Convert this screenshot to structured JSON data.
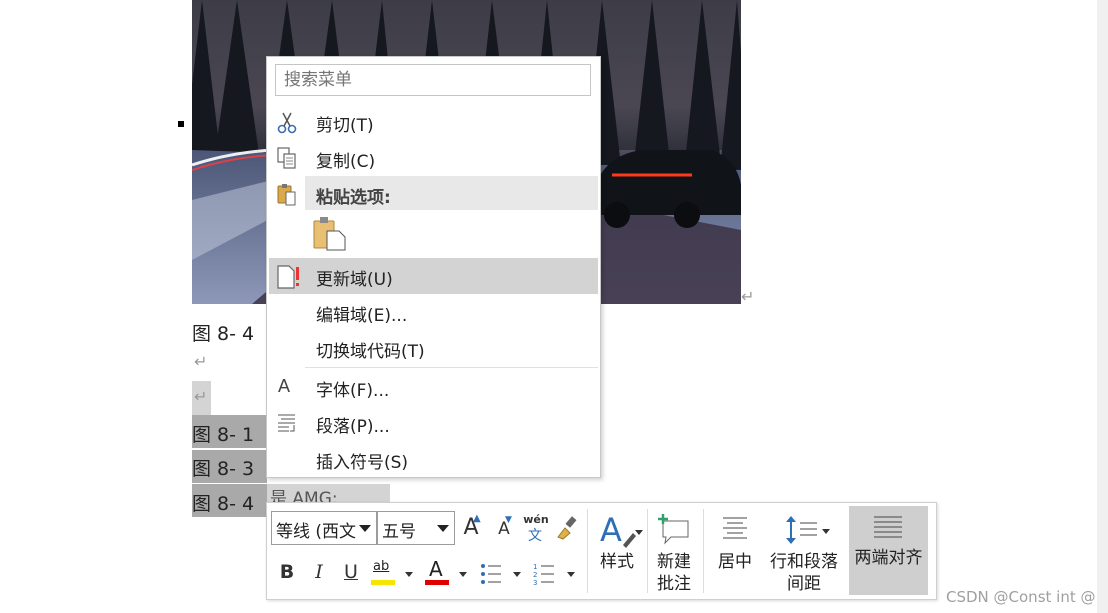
{
  "document": {
    "figure_caption_top": "图 8- 4",
    "captions": [
      {
        "label": "图 8- 1"
      },
      {
        "label": "图 8- 3"
      },
      {
        "label": "图 8- 4",
        "rest": "是 AMG:"
      }
    ],
    "pilcrow": "↵"
  },
  "context_menu": {
    "search_placeholder": "搜索菜单",
    "items": [
      {
        "label": "剪切(T)",
        "icon": "scissors-icon"
      },
      {
        "label": "复制(C)",
        "icon": "copy-icon"
      },
      {
        "label": "粘贴选项:",
        "icon": "paste-icon"
      },
      {
        "label": "更新域(U)",
        "icon": "update-field-icon"
      },
      {
        "label": "编辑域(E)..."
      },
      {
        "label": "切换域代码(T)"
      },
      {
        "label": "字体(F)...",
        "icon": "font-icon"
      },
      {
        "label": "段落(P)...",
        "icon": "paragraph-icon"
      },
      {
        "label": "插入符号(S)"
      }
    ],
    "font_icon_letter": "A"
  },
  "mini_toolbar": {
    "font_name": "等线 (西文",
    "font_size": "五号",
    "grow_font": "A",
    "shrink_font": "A",
    "phonetic_top": "wén",
    "phonetic_bottom": "文",
    "bold": "B",
    "italic": "I",
    "underline": "U",
    "highlight_text": "ab",
    "font_color_letter": "A",
    "styles_label": "样式",
    "new_comment_label_1": "新建",
    "new_comment_label_2": "批注",
    "center_label": "居中",
    "line_spacing_label_1": "行和段落",
    "line_spacing_label_2": "间距",
    "justify_label": "两端对齐",
    "colors": {
      "highlight": "#f5e600",
      "font_color": "#e00000",
      "accent_blue": "#2e6fb6"
    }
  },
  "watermark": "CSDN @Const int @"
}
